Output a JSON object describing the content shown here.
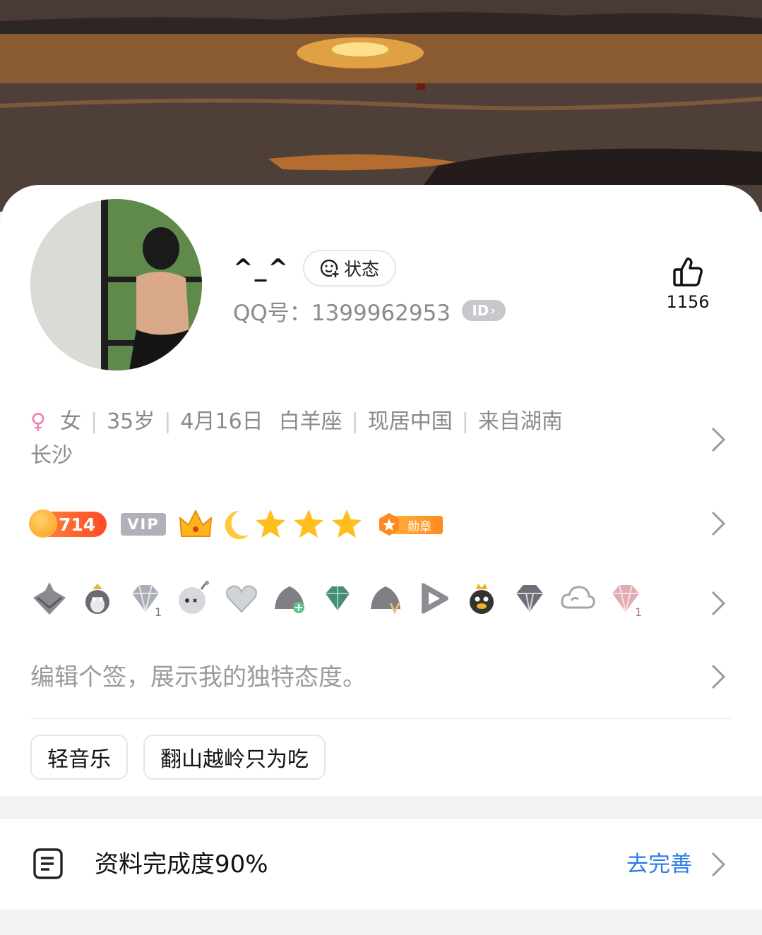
{
  "profile": {
    "nickname": "^_^",
    "status_label": "状态",
    "qq_number_text": "QQ号：1399962953",
    "id_badge": "ID",
    "like_count": "1156"
  },
  "info": {
    "gender": "女",
    "age": "35岁",
    "birthday": "4月16日",
    "zodiac": "白羊座",
    "residence": "现居中国",
    "hometown": "来自湖南",
    "hometown_city": "长沙"
  },
  "badges": {
    "level": "714",
    "vip": "VIP",
    "medal": "勋章",
    "level_icons": [
      "crown-icon",
      "moon-icon",
      "star-icon",
      "star-icon",
      "star-icon"
    ]
  },
  "service_icons": [
    "gray-helmet-icon",
    "penguin-icon",
    "diamond-1-icon",
    "bomb-face-icon",
    "heart-icon",
    "gray-hat-plus-icon",
    "green-gem-icon",
    "gray-hat-v-icon",
    "play-icon",
    "penguin-crown-icon",
    "dark-diamond-icon",
    "cloud-icon",
    "pink-diamond-1-icon"
  ],
  "signature_placeholder": "编辑个签，展示我的独特态度。",
  "interest_tags": [
    "轻音乐",
    "翻山越岭只为吃"
  ],
  "completion": {
    "label": "资料完成度90%",
    "action": "去完善"
  },
  "colors": {
    "accent_blue": "#2b7de9",
    "female_pink": "#f07fb1",
    "level_orange": "#ff5a28"
  }
}
